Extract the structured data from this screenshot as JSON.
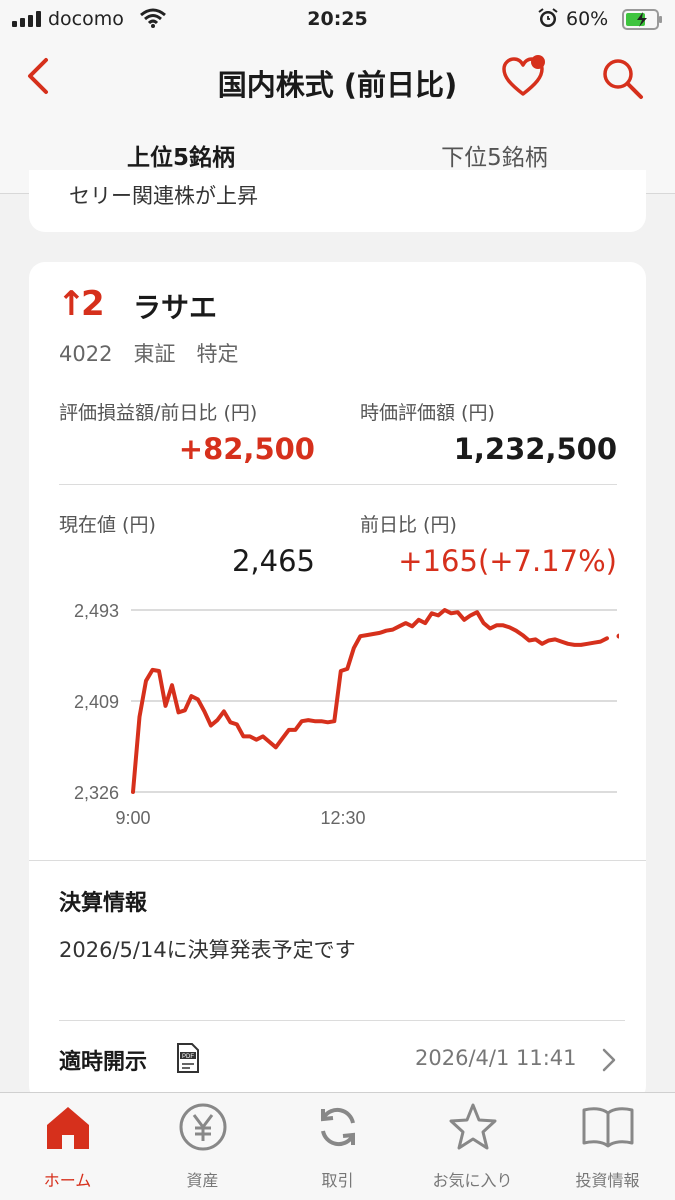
{
  "status_bar": {
    "carrier": "docomo",
    "time": "20:25",
    "battery": "60%"
  },
  "nav": {
    "title": "国内株式 (前日比)",
    "icons": [
      "back-chevron-icon",
      "favorite-heart-icon",
      "search-icon"
    ]
  },
  "tabs": [
    {
      "label": "上位5銘柄",
      "selected": true
    },
    {
      "label": "下位5銘柄",
      "selected": false
    }
  ],
  "prev_card_text": "セリー関連株が上昇",
  "stock": {
    "rank_arrow": "↑",
    "rank": "2",
    "name": "ラサエ",
    "meta": "4022　東証　特定",
    "pl_label": "評価損益額/前日比 (円)",
    "pl_value": "+82,500",
    "market_value_label": "時価評価額 (円)",
    "market_value": "1,232,500",
    "price_label": "現在値 (円)",
    "price": "2,465",
    "change_label": "前日比 (円)",
    "change": "+165",
    "change_pct": "(+7.17%)"
  },
  "chart_data": {
    "type": "line",
    "y_ticks": [
      "2,493",
      "2,409",
      "2,326"
    ],
    "x_ticks": [
      "9:00",
      "12:30"
    ],
    "ylim": [
      2326,
      2493
    ],
    "grid": true,
    "color": "#d6301c",
    "series": [
      {
        "values": [
          2326,
          2395,
          2428,
          2438,
          2437,
          2405,
          2424,
          2399,
          2401,
          2414,
          2411,
          2400,
          2387,
          2392,
          2400,
          2390,
          2388,
          2377,
          2377,
          2374,
          2377,
          2372,
          2367,
          2375,
          2383,
          2383,
          2391,
          2392,
          2391,
          2391,
          2390,
          2391,
          2437,
          2439,
          2458,
          2469,
          2470,
          2471,
          2472,
          2474,
          2475,
          2478,
          2481,
          2478,
          2484,
          2481,
          2490,
          2488,
          2493,
          2490,
          2491,
          2484,
          2488,
          2491,
          2481,
          2476,
          2479,
          2479,
          2477,
          2474,
          2470,
          2465,
          2466,
          2462,
          2465,
          2466,
          2464,
          2462,
          2461,
          2461,
          2462,
          2463,
          2464,
          2467
        ]
      }
    ]
  },
  "settlement": {
    "title": "決算情報",
    "text": "2026/5/14に決算発表予定です"
  },
  "disclosure": {
    "title": "適時開示",
    "date": "2026/4/1 11:41"
  },
  "tabbar": [
    {
      "label": "ホーム",
      "icon": "home-icon",
      "active": true
    },
    {
      "label": "資産",
      "icon": "yen-icon",
      "active": false
    },
    {
      "label": "取引",
      "icon": "trade-icon",
      "active": false
    },
    {
      "label": "お気に入り",
      "icon": "star-icon",
      "active": false
    },
    {
      "label": "投資情報",
      "icon": "book-icon",
      "active": false
    }
  ]
}
